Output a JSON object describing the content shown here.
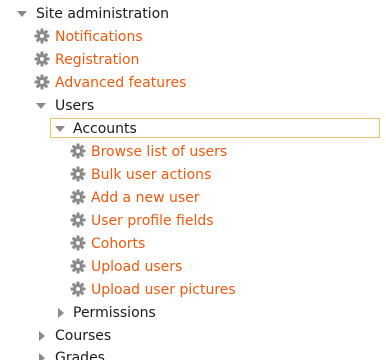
{
  "nav": {
    "root": {
      "label": "Site administration",
      "icon": "expanded-triangle-icon"
    },
    "notifications": {
      "label": "Notifications",
      "icon": "gear-icon"
    },
    "registration": {
      "label": "Registration",
      "icon": "gear-icon"
    },
    "advanced_features": {
      "label": "Advanced features",
      "icon": "gear-icon"
    },
    "users": {
      "label": "Users",
      "icon": "expanded-triangle-icon"
    },
    "accounts": {
      "label": "Accounts",
      "icon": "expanded-triangle-icon",
      "focused": true,
      "items": [
        {
          "label": "Browse list of users",
          "icon": "gear-icon"
        },
        {
          "label": "Bulk user actions",
          "icon": "gear-icon"
        },
        {
          "label": "Add a new user",
          "icon": "gear-icon"
        },
        {
          "label": "User profile fields",
          "icon": "gear-icon"
        },
        {
          "label": "Cohorts",
          "icon": "gear-icon"
        },
        {
          "label": "Upload users",
          "icon": "gear-icon"
        },
        {
          "label": "Upload user pictures",
          "icon": "gear-icon"
        }
      ]
    },
    "permissions": {
      "label": "Permissions",
      "icon": "collapsed-triangle-icon"
    },
    "courses": {
      "label": "Courses",
      "icon": "collapsed-triangle-icon"
    },
    "grades": {
      "label": "Grades",
      "icon": "collapsed-triangle-icon"
    }
  },
  "colors": {
    "link": "#ee5a10",
    "category_text": "#1a1a1a",
    "triangle": "#8a8a8a",
    "gear": "#8a8a8a",
    "focus_border": "#e3c46a"
  }
}
